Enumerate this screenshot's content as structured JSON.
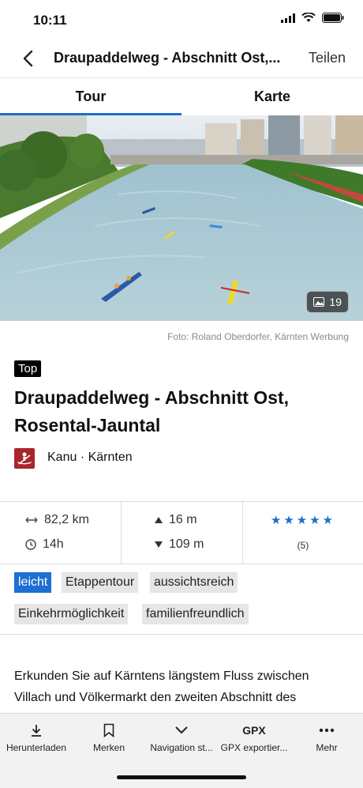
{
  "status": {
    "time": "10:11"
  },
  "nav": {
    "title": "Draupaddelweg - Abschnitt Ost,...",
    "share": "Teilen"
  },
  "tabs": [
    {
      "label": "Tour"
    },
    {
      "label": "Karte"
    }
  ],
  "hero": {
    "photo_count": "19",
    "credit": "Foto: Roland Oberdorfer, Kärnten Werbung"
  },
  "badge": "Top",
  "title": "Draupaddelweg - Abschnitt Ost, Rosental-Jauntal",
  "category": "Kanu · Kärnten",
  "stats": {
    "distance": "82,2 km",
    "duration": "14h",
    "ascent": "16 m",
    "descent": "109 m",
    "stars": "★★★★★",
    "rating_count": "(5)"
  },
  "tags": [
    "leicht",
    "Etappentour",
    "aussichtsreich",
    "Einkehrmöglichkeit",
    "familienfreundlich"
  ],
  "description": "Erkunden Sie auf Kärntens längstem Fluss zwischen Villach und Völkermarkt den zweiten Abschnitt des Draupaddelweges auf der Kajak-Kanu-Route ...",
  "toolbar": {
    "download": "Herunterladen",
    "bookmark": "Merken",
    "navigation": "Navigation st...",
    "gpx_icon": "GPX",
    "gpx": "GPX exportier...",
    "more": "Mehr"
  },
  "colors": {
    "accent": "#1d6fd1",
    "category": "#a9262b"
  }
}
